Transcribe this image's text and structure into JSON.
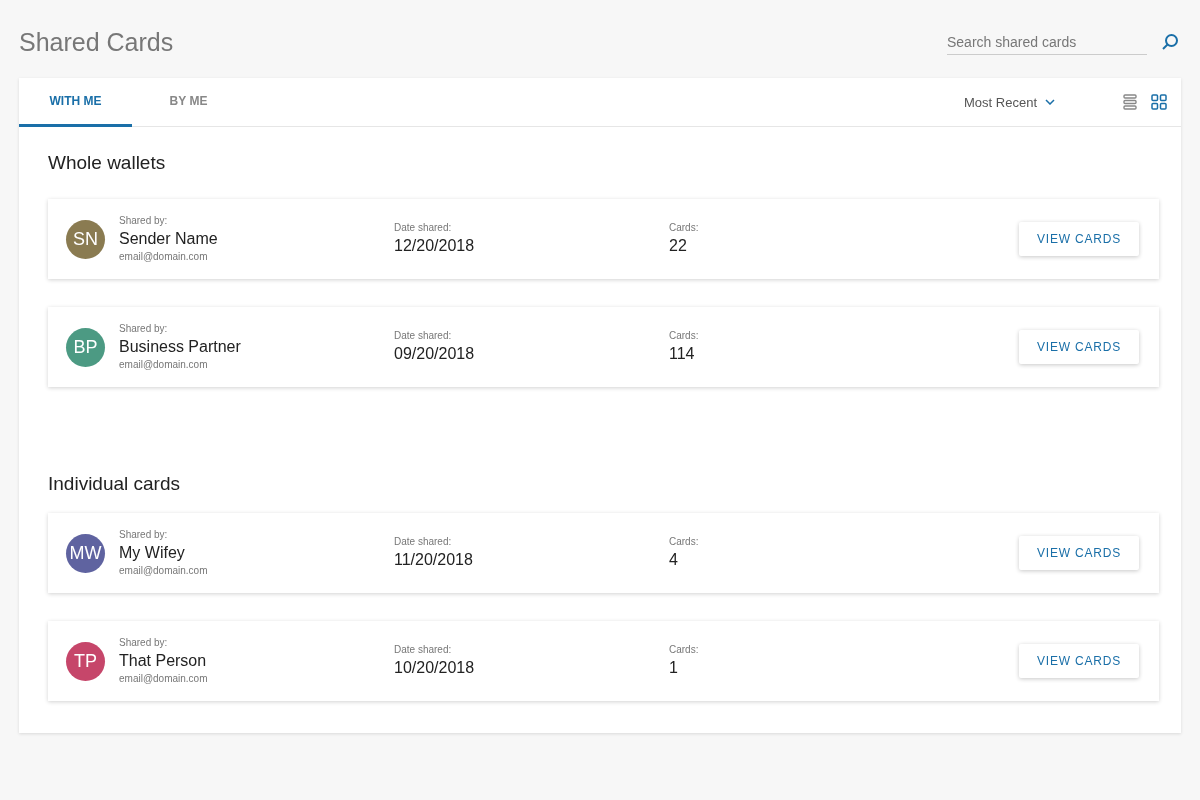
{
  "title": "Shared Cards",
  "search": {
    "placeholder": "Search shared cards"
  },
  "tabs": [
    {
      "label": "WITH ME",
      "selected": true
    },
    {
      "label": "BY ME",
      "selected": false
    }
  ],
  "sort": {
    "label": "Most Recent"
  },
  "view_modes": [
    {
      "kind": "list",
      "selected": false
    },
    {
      "kind": "grid",
      "selected": true
    }
  ],
  "sections": [
    {
      "heading": "Whole wallets",
      "items": [
        {
          "initials": "SN",
          "color": "#8a7b51",
          "shared_by_label": "Shared by:",
          "name": "Sender Name",
          "email": "email@domain.com",
          "date_label": "Date shared:",
          "date": "12/20/2018",
          "cards_label": "Cards:",
          "cards": "22",
          "button": "VIEW CARDS"
        },
        {
          "initials": "BP",
          "color": "#4c9a83",
          "shared_by_label": "Shared by:",
          "name": "Business Partner",
          "email": "email@domain.com",
          "date_label": "Date shared:",
          "date": "09/20/2018",
          "cards_label": "Cards:",
          "cards": "114",
          "button": "VIEW CARDS"
        }
      ]
    },
    {
      "heading": "Individual cards",
      "items": [
        {
          "initials": "MW",
          "color": "#5f63a0",
          "shared_by_label": "Shared by:",
          "name": "My Wifey",
          "email": "email@domain.com",
          "date_label": "Date shared:",
          "date": "11/20/2018",
          "cards_label": "Cards:",
          "cards": "4",
          "button": "VIEW CARDS"
        },
        {
          "initials": "TP",
          "color": "#c6466a",
          "shared_by_label": "Shared by:",
          "name": "That Person",
          "email": "email@domain.com",
          "date_label": "Date shared:",
          "date": "10/20/2018",
          "cards_label": "Cards:",
          "cards": "1",
          "button": "VIEW CARDS"
        }
      ]
    }
  ]
}
